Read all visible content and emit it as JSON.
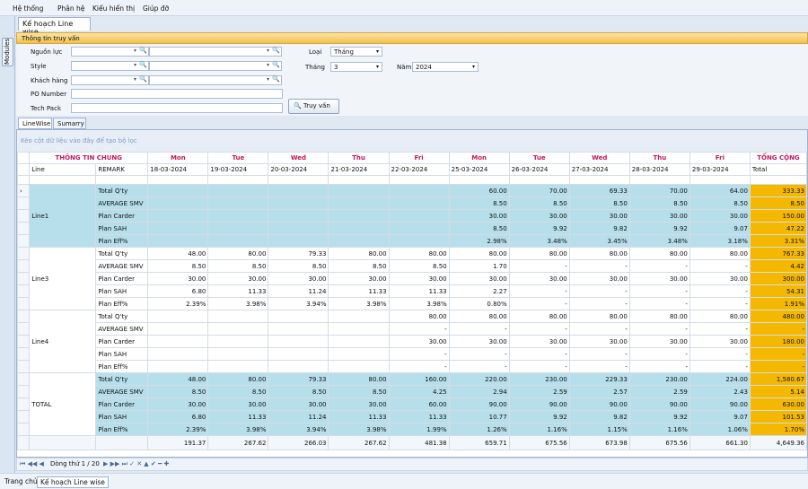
{
  "menu": [
    "Hệ thống",
    "Phân hệ",
    "Kiểu hiển thị",
    "Giúp đỡ"
  ],
  "modules_label": "Modules",
  "doc_tab": "Kế hoạch Line wise",
  "panel_header": "Thông tin truy vấn",
  "form": {
    "nguon_luc": "Nguồn lực",
    "style": "Style",
    "khach_hang": "Khách hàng",
    "po_number": "PO Number",
    "tech_pack": "Tech Pack",
    "loai_label": "Loại",
    "loai_value": "Tháng",
    "thang_label": "Tháng",
    "thang_value": "3",
    "nam_label": "Năm",
    "nam_value": "2024",
    "search_button": "Truy vấn"
  },
  "tabs": [
    "LineWise",
    "Sumarry"
  ],
  "group_hint": "Kéo cột dữ liệu vào đây để tạo bộ lọc",
  "header_top": [
    "THÔNG TIN CHUNG",
    "Mon",
    "Tue",
    "Wed",
    "Thu",
    "Fri",
    "Mon",
    "Tue",
    "Wed",
    "Thu",
    "Fri",
    "TỔNG CỘNG"
  ],
  "header_sub": [
    "Line",
    "REMARK",
    "18-03-2024",
    "19-03-2024",
    "20-03-2024",
    "21-03-2024",
    "22-03-2024",
    "25-03-2024",
    "26-03-2024",
    "27-03-2024",
    "28-03-2024",
    "29-03-2024",
    "Total"
  ],
  "rows": [
    {
      "line": "Line1",
      "remark": "Total Q'ty",
      "vals": [
        "",
        "",
        "",
        "",
        "",
        "60.00",
        "70.00",
        "69.33",
        "70.00",
        "64.00",
        "333.33"
      ]
    },
    {
      "line": "",
      "remark": "AVERAGE SMV",
      "vals": [
        "",
        "",
        "",
        "",
        "",
        "8.50",
        "8.50",
        "8.50",
        "8.50",
        "8.50",
        "8.50"
      ]
    },
    {
      "line": "",
      "remark": "Plan Carder",
      "vals": [
        "",
        "",
        "",
        "",
        "",
        "30.00",
        "30.00",
        "30.00",
        "30.00",
        "30.00",
        "150.00"
      ]
    },
    {
      "line": "",
      "remark": "Plan SAH",
      "vals": [
        "",
        "",
        "",
        "",
        "",
        "8.50",
        "9.92",
        "9.82",
        "9.92",
        "9.07",
        "47.22"
      ]
    },
    {
      "line": "",
      "remark": "Plan Eff%",
      "vals": [
        "",
        "",
        "",
        "",
        "",
        "2.98%",
        "3.48%",
        "3.45%",
        "3.48%",
        "3.18%",
        "3.31%"
      ]
    },
    {
      "line": "Line3",
      "remark": "Total Q'ty",
      "vals": [
        "48.00",
        "80.00",
        "79.33",
        "80.00",
        "80.00",
        "80.00",
        "80.00",
        "80.00",
        "80.00",
        "80.00",
        "767.33"
      ]
    },
    {
      "line": "",
      "remark": "AVERAGE SMV",
      "vals": [
        "8.50",
        "8.50",
        "8.50",
        "8.50",
        "8.50",
        "1.70",
        "-",
        "-",
        "-",
        "-",
        "4.42"
      ]
    },
    {
      "line": "",
      "remark": "Plan Carder",
      "vals": [
        "30.00",
        "30.00",
        "30.00",
        "30.00",
        "30.00",
        "30.00",
        "30.00",
        "30.00",
        "30.00",
        "30.00",
        "300.00"
      ]
    },
    {
      "line": "",
      "remark": "Plan SAH",
      "vals": [
        "6.80",
        "11.33",
        "11.24",
        "11.33",
        "11.33",
        "2.27",
        "-",
        "-",
        "-",
        "-",
        "54.31"
      ]
    },
    {
      "line": "",
      "remark": "Plan Eff%",
      "vals": [
        "2.39%",
        "3.98%",
        "3.94%",
        "3.98%",
        "3.98%",
        "0.80%",
        "-",
        "-",
        "-",
        "-",
        "1.91%"
      ]
    },
    {
      "line": "Line4",
      "remark": "Total Q'ty",
      "vals": [
        "",
        "",
        "",
        "",
        "80.00",
        "80.00",
        "80.00",
        "80.00",
        "80.00",
        "80.00",
        "480.00"
      ]
    },
    {
      "line": "",
      "remark": "AVERAGE SMV",
      "vals": [
        "",
        "",
        "",
        "",
        "-",
        "-",
        "-",
        "-",
        "-",
        "-",
        "-"
      ]
    },
    {
      "line": "",
      "remark": "Plan Carder",
      "vals": [
        "",
        "",
        "",
        "",
        "30.00",
        "30.00",
        "30.00",
        "30.00",
        "30.00",
        "30.00",
        "180.00"
      ]
    },
    {
      "line": "",
      "remark": "Plan SAH",
      "vals": [
        "",
        "",
        "",
        "",
        "-",
        "-",
        "-",
        "-",
        "-",
        "-",
        "-"
      ]
    },
    {
      "line": "",
      "remark": "Plan Eff%",
      "vals": [
        "",
        "",
        "",
        "",
        "-",
        "-",
        "-",
        "-",
        "-",
        "-",
        "-"
      ]
    },
    {
      "line": "TOTAL",
      "remark": "Total Q'ty",
      "vals": [
        "48.00",
        "80.00",
        "79.33",
        "80.00",
        "160.00",
        "220.00",
        "230.00",
        "229.33",
        "230.00",
        "224.00",
        "1,580.67"
      ]
    },
    {
      "line": "",
      "remark": "AVERAGE SMV",
      "vals": [
        "8.50",
        "8.50",
        "8.50",
        "8.50",
        "4.25",
        "2.94",
        "2.59",
        "2.57",
        "2.59",
        "2.43",
        "5.14"
      ]
    },
    {
      "line": "",
      "remark": "Plan Carder",
      "vals": [
        "30.00",
        "30.00",
        "30.00",
        "30.00",
        "60.00",
        "90.00",
        "90.00",
        "90.00",
        "90.00",
        "90.00",
        "630.00"
      ]
    },
    {
      "line": "",
      "remark": "Plan SAH",
      "vals": [
        "6.80",
        "11.33",
        "11.24",
        "11.33",
        "11.33",
        "10.77",
        "9.92",
        "9.82",
        "9.92",
        "9.07",
        "101.53"
      ]
    },
    {
      "line": "",
      "remark": "Plan Eff%",
      "vals": [
        "2.39%",
        "3.98%",
        "3.94%",
        "3.98%",
        "1.99%",
        "1.26%",
        "1.16%",
        "1.15%",
        "1.16%",
        "1.06%",
        "1.70%"
      ]
    }
  ],
  "footer": [
    "191.37",
    "267.62",
    "266.03",
    "267.62",
    "481.38",
    "659.71",
    "675.56",
    "673.98",
    "675.56",
    "661.30",
    "4,649.36"
  ],
  "navigator": "Dòng thứ 1 / 20",
  "status_tabs": [
    "Trang chủ",
    "Kế hoạch Line wise"
  ],
  "colors": {
    "accent_header": "#c2185b",
    "group_blue": "#b7dfeb",
    "total_gold": "#f5b800"
  }
}
